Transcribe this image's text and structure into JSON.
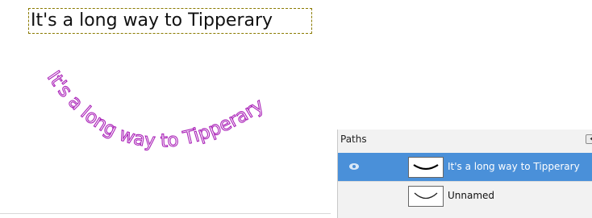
{
  "canvas": {
    "text_layer": "It's a long way to Tipperary",
    "curved_text": "It's a long way to Tipperary",
    "curved_text_color": "#aa22b8"
  },
  "paths_panel": {
    "title": "Paths",
    "items": [
      {
        "name": "It's a long way to Tipperary",
        "visible": true,
        "selected": true
      },
      {
        "name": "Unnamed",
        "visible": false,
        "selected": false
      }
    ]
  },
  "colors": {
    "selection": "#4a90d9",
    "text_box_border": "#f2d800"
  }
}
